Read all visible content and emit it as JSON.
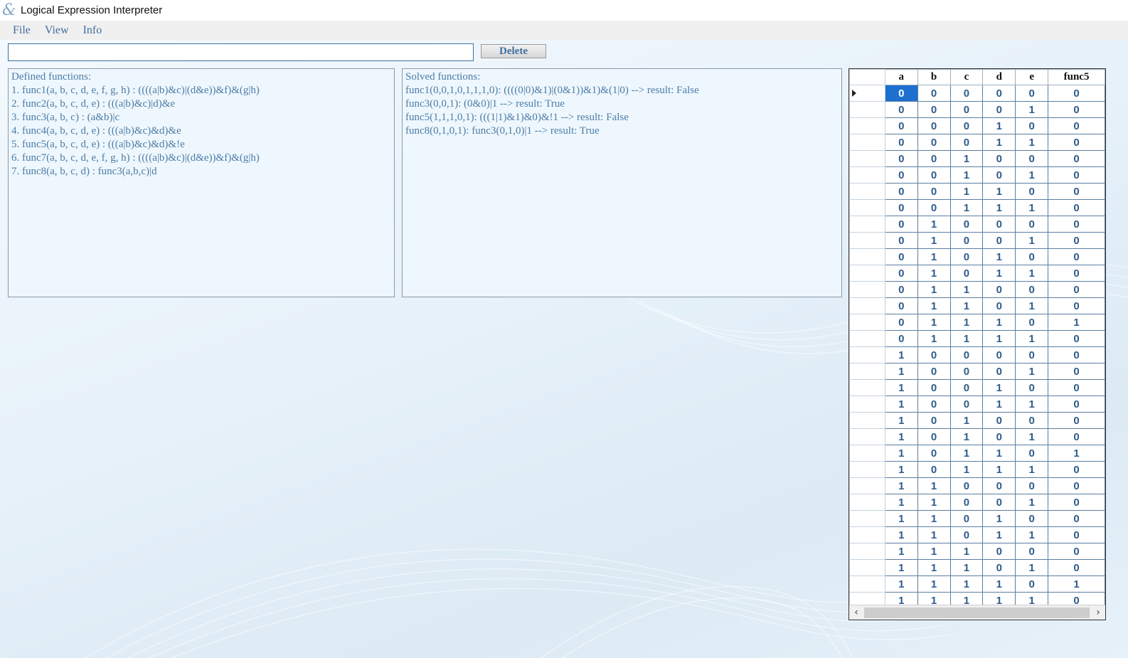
{
  "window": {
    "title": "Logical Expression Interpreter",
    "icon": "&"
  },
  "menu": {
    "items": [
      {
        "label": "File"
      },
      {
        "label": "View"
      },
      {
        "label": "Info"
      }
    ]
  },
  "toolbar": {
    "input_value": "",
    "delete_label": "Delete"
  },
  "defined": {
    "header": "Defined functions:",
    "lines": [
      "1. func1(a, b, c, d, e, f, g, h) : ((((a|b)&c)|(d&e))&f)&(g|h)",
      "2. func2(a, b, c, d, e) : (((a|b)&c)|d)&e",
      "3. func3(a, b, c) : (a&b)|c",
      "4. func4(a, b, c, d, e) : (((a|b)&c)&d)&e",
      "5. func5(a, b, c, d, e) : (((a|b)&c)&d)&!e",
      "6. func7(a, b, c, d, e, f, g, h) : ((((a|b)&c)|(d&e))&f)&(g|h)",
      "7. func8(a, b, c, d) : func3(a,b,c)|d"
    ]
  },
  "solved": {
    "header": "Solved functions:",
    "lines": [
      "func1(0,0,1,0,1,1,1,0): ((((0|0)&1)|(0&1))&1)&(1|0) --> result: False",
      "func3(0,0,1): (0&0)|1 --> result: True",
      "func5(1,1,1,0,1): (((1|1)&1)&0)&!1 --> result: False",
      "func8(0,1,0,1): func3(0,1,0)|1 --> result: True"
    ]
  },
  "truth_table": {
    "columns": [
      "a",
      "b",
      "c",
      "d",
      "e",
      "func5"
    ],
    "rows": [
      [
        "0",
        "0",
        "0",
        "0",
        "0",
        "0"
      ],
      [
        "0",
        "0",
        "0",
        "0",
        "1",
        "0"
      ],
      [
        "0",
        "0",
        "0",
        "1",
        "0",
        "0"
      ],
      [
        "0",
        "0",
        "0",
        "1",
        "1",
        "0"
      ],
      [
        "0",
        "0",
        "1",
        "0",
        "0",
        "0"
      ],
      [
        "0",
        "0",
        "1",
        "0",
        "1",
        "0"
      ],
      [
        "0",
        "0",
        "1",
        "1",
        "0",
        "0"
      ],
      [
        "0",
        "0",
        "1",
        "1",
        "1",
        "0"
      ],
      [
        "0",
        "1",
        "0",
        "0",
        "0",
        "0"
      ],
      [
        "0",
        "1",
        "0",
        "0",
        "1",
        "0"
      ],
      [
        "0",
        "1",
        "0",
        "1",
        "0",
        "0"
      ],
      [
        "0",
        "1",
        "0",
        "1",
        "1",
        "0"
      ],
      [
        "0",
        "1",
        "1",
        "0",
        "0",
        "0"
      ],
      [
        "0",
        "1",
        "1",
        "0",
        "1",
        "0"
      ],
      [
        "0",
        "1",
        "1",
        "1",
        "0",
        "1"
      ],
      [
        "0",
        "1",
        "1",
        "1",
        "1",
        "0"
      ],
      [
        "1",
        "0",
        "0",
        "0",
        "0",
        "0"
      ],
      [
        "1",
        "0",
        "0",
        "0",
        "1",
        "0"
      ],
      [
        "1",
        "0",
        "0",
        "1",
        "0",
        "0"
      ],
      [
        "1",
        "0",
        "0",
        "1",
        "1",
        "0"
      ],
      [
        "1",
        "0",
        "1",
        "0",
        "0",
        "0"
      ],
      [
        "1",
        "0",
        "1",
        "0",
        "1",
        "0"
      ],
      [
        "1",
        "0",
        "1",
        "1",
        "0",
        "1"
      ],
      [
        "1",
        "0",
        "1",
        "1",
        "1",
        "0"
      ],
      [
        "1",
        "1",
        "0",
        "0",
        "0",
        "0"
      ],
      [
        "1",
        "1",
        "0",
        "0",
        "1",
        "0"
      ],
      [
        "1",
        "1",
        "0",
        "1",
        "0",
        "0"
      ],
      [
        "1",
        "1",
        "0",
        "1",
        "1",
        "0"
      ],
      [
        "1",
        "1",
        "1",
        "0",
        "0",
        "0"
      ],
      [
        "1",
        "1",
        "1",
        "0",
        "1",
        "0"
      ],
      [
        "1",
        "1",
        "1",
        "1",
        "0",
        "1"
      ],
      [
        "1",
        "1",
        "1",
        "1",
        "1",
        "0"
      ]
    ],
    "selected_row": 0,
    "selected_col": 0
  },
  "colors": {
    "accent": "#4d7ca6",
    "selection": "#1d6fd0"
  }
}
